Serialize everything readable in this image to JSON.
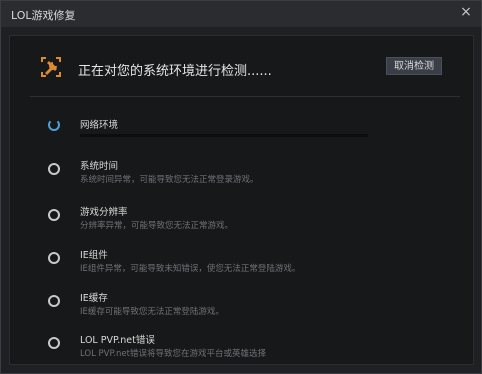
{
  "window": {
    "title": "LOL游戏修复",
    "close_glyph": "×"
  },
  "header": {
    "status_text": "正在对您的系统环境进行检测......",
    "cancel_button": "取消检测"
  },
  "items": [
    {
      "title": "网络环境",
      "desc": "",
      "state": "checking",
      "progress": 0.0
    },
    {
      "title": "系统时间",
      "desc": "系统时间异常，可能导致您无法正常登录游戏。",
      "state": "pending"
    },
    {
      "title": "游戏分辨率",
      "desc": "分辨率异常，可能导致您无法正常游戏。",
      "state": "pending"
    },
    {
      "title": "IE组件",
      "desc": "IE组件异常，可能导致未知错误，使您无法正常登陆游戏。",
      "state": "pending"
    },
    {
      "title": "IE缓存",
      "desc": "IE缓存可能导致您无法正常登陆游戏。",
      "state": "pending"
    },
    {
      "title": "LOL PVP.net错误",
      "desc": "LOL PVP.net错误将导致您在游戏平台或英雄选择",
      "state": "pending"
    }
  ],
  "colors": {
    "accent": "#4aa3d7",
    "warning_icon": "#e08a2e"
  },
  "icons": {
    "header": "wrench-screwdriver-icon",
    "status_checking": "spinner-icon",
    "status_pending": "pending-circle-icon"
  }
}
